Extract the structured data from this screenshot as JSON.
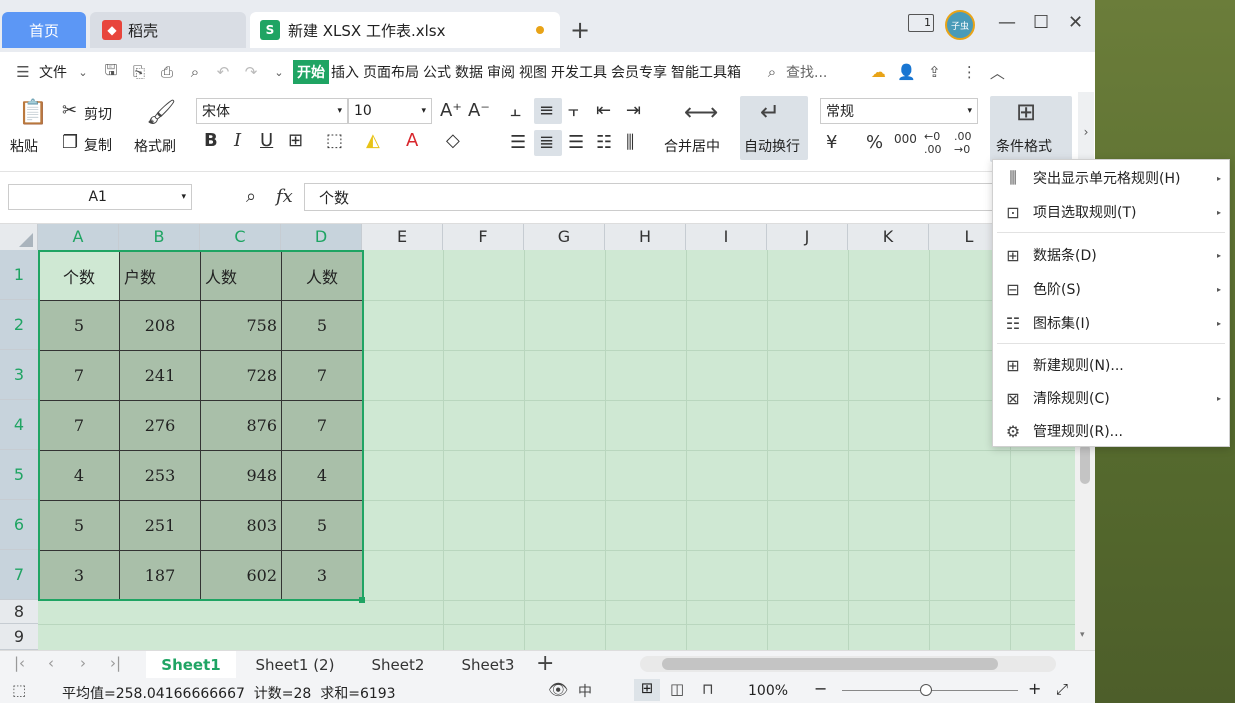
{
  "titlebar": {
    "tabs": [
      {
        "label": "首页"
      },
      {
        "label": "稻壳"
      },
      {
        "label": "新建 XLSX 工作表.xlsx"
      }
    ],
    "avatar_text": "子虫",
    "page_badge": "1"
  },
  "menubar": {
    "file_label": "文件",
    "items": [
      "开始",
      "插入",
      "页面布局",
      "公式",
      "数据",
      "审阅",
      "视图",
      "开发工具",
      "会员专享",
      "智能工具箱"
    ],
    "search_placeholder": "查找..."
  },
  "ribbon": {
    "paste": "粘贴",
    "cut": "剪切",
    "copy": "复制",
    "format_painter": "格式刷",
    "font_name": "宋体",
    "font_size": "10",
    "merge_center": "合并居中",
    "wrap_text": "自动换行",
    "number_format": "常规",
    "cond_format": "条件格式"
  },
  "formula_bar": {
    "cell_ref": "A1",
    "fx": "fx",
    "content": "个数"
  },
  "grid": {
    "columns": [
      "A",
      "B",
      "C",
      "D",
      "E",
      "F",
      "G",
      "H",
      "I",
      "J",
      "K",
      "L"
    ],
    "rows": [
      "1",
      "2",
      "3",
      "4",
      "5",
      "6",
      "7",
      "8",
      "9"
    ],
    "data": [
      [
        "个数",
        "户数",
        "人数",
        "人数"
      ],
      [
        "5",
        "208",
        "758",
        "5"
      ],
      [
        "7",
        "241",
        "728",
        "7"
      ],
      [
        "7",
        "276",
        "876",
        "7"
      ],
      [
        "4",
        "253",
        "948",
        "4"
      ],
      [
        "5",
        "251",
        "803",
        "5"
      ],
      [
        "3",
        "187",
        "602",
        "3"
      ]
    ]
  },
  "sheets": [
    "Sheet1",
    "Sheet1 (2)",
    "Sheet2",
    "Sheet3"
  ],
  "status": {
    "summary": "平均值=258.04166666667  计数=28  求和=6193",
    "zoom": "100%"
  },
  "dropdown": {
    "items": [
      {
        "label": "突出显示单元格规则(H)",
        "icon": "highlight-rules-icon"
      },
      {
        "label": "项目选取规则(T)",
        "icon": "top-bottom-rules-icon"
      },
      {
        "label": "数据条(D)",
        "icon": "data-bars-icon"
      },
      {
        "label": "色阶(S)",
        "icon": "color-scales-icon"
      },
      {
        "label": "图标集(I)",
        "icon": "icon-sets-icon"
      },
      {
        "label": "新建规则(N)...",
        "icon": "new-rule-icon"
      },
      {
        "label": "清除规则(C)",
        "icon": "clear-rules-icon"
      },
      {
        "label": "管理规则(R)...",
        "icon": "manage-rules-icon"
      }
    ]
  }
}
